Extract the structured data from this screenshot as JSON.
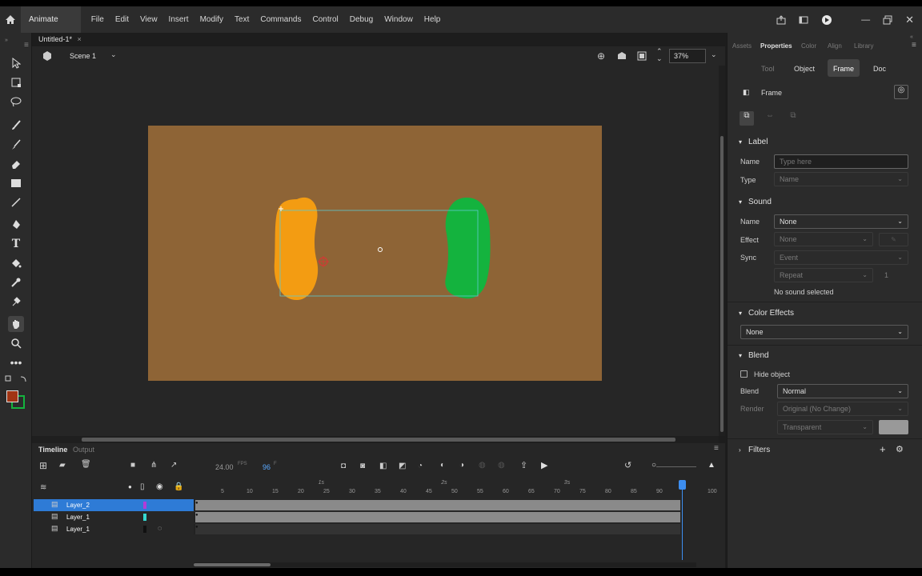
{
  "app": {
    "name": "Animate"
  },
  "menu": [
    "File",
    "Edit",
    "View",
    "Insert",
    "Modify",
    "Text",
    "Commands",
    "Control",
    "Debug",
    "Window",
    "Help"
  ],
  "document": {
    "tab": "Untitled-1*",
    "scene": "Scene 1",
    "zoom": "37%"
  },
  "right_tabs": [
    "Assets",
    "Properties",
    "Color",
    "Align",
    "Library"
  ],
  "props_tabs": [
    "Tool",
    "Object",
    "Frame",
    "Doc"
  ],
  "props": {
    "header": "Frame",
    "label_section": "Label",
    "name_label": "Name",
    "name_placeholder": "Type here",
    "type_label": "Type",
    "type_value": "Name",
    "sound_section": "Sound",
    "sound_name_label": "Name",
    "sound_name_value": "None",
    "effect_label": "Effect",
    "effect_value": "None",
    "sync_label": "Sync",
    "sync_value": "Event",
    "repeat_value": "Repeat",
    "repeat_count": "1",
    "no_sound": "No sound selected",
    "color_effects_section": "Color Effects",
    "color_effects_value": "None",
    "blend_section": "Blend",
    "hide_object": "Hide object",
    "blend_label": "Blend",
    "blend_value": "Normal",
    "render_label": "Render",
    "render_value": "Original (No Change)",
    "transparent_value": "Transparent",
    "filters_section": "Filters"
  },
  "timeline": {
    "tabs": [
      "Timeline",
      "Output"
    ],
    "fps": "24.00",
    "fps_unit": "FPS",
    "frame": "96",
    "frame_unit": "F",
    "seconds": [
      "1s",
      "2s",
      "3s"
    ],
    "ruler": [
      "5",
      "10",
      "15",
      "20",
      "25",
      "30",
      "35",
      "40",
      "45",
      "50",
      "55",
      "60",
      "65",
      "70",
      "75",
      "80",
      "85",
      "90",
      "100"
    ],
    "layers": [
      {
        "name": "Layer_2",
        "color": "#b13cd8",
        "selected": true
      },
      {
        "name": "Layer_1",
        "color": "#35d7d0",
        "selected": false
      },
      {
        "name": "Layer_1",
        "color": "#111111",
        "selected": false
      }
    ]
  },
  "colors": {
    "stage": "#8e6436",
    "orange_shape": "#f39c12",
    "green_shape": "#14b33e",
    "accent": "#2e7bd6"
  }
}
